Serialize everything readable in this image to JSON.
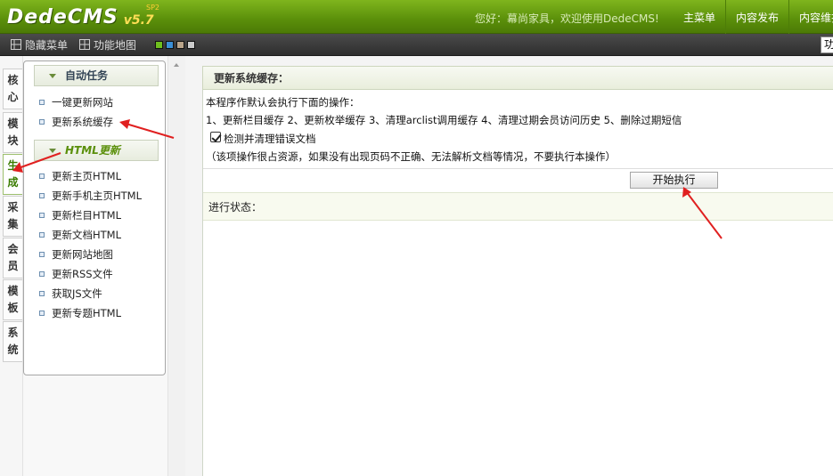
{
  "header": {
    "logo_text": "DedeCMS",
    "logo_version": "v5.7",
    "logo_edition": "SP2",
    "welcome": "您好：幕尚家具，欢迎使用DedeCMS!",
    "nav": [
      "主菜单",
      "内容发布",
      "内容维护"
    ]
  },
  "toolbar": {
    "hide_menu": "隐藏菜单",
    "site_map": "功能地图",
    "skins": [
      "#6fbf1e",
      "#3b8fd6",
      "#b9a48a",
      "#cccccc"
    ],
    "right_box": "功"
  },
  "vtabs": [
    "核心",
    "模块",
    "生成",
    "采集",
    "会员",
    "模板",
    "系统"
  ],
  "menu": {
    "group1_title": "自动任务",
    "group1_items": [
      "一键更新网站",
      "更新系统缓存"
    ],
    "group2_title": "HTML更新",
    "group2_items": [
      "更新主页HTML",
      "更新手机主页HTML",
      "更新栏目HTML",
      "更新文档HTML",
      "更新网站地图",
      "更新RSS文件",
      "获取JS文件",
      "更新专题HTML"
    ]
  },
  "main": {
    "title": "更新系统缓存：",
    "line1": "本程序作默认会执行下面的操作：",
    "line2": "1、更新栏目缓存 2、更新枚举缓存 3、清理arclist调用缓存 4、清理过期会员访问历史 5、删除过期短信",
    "check_label": "检测并清理错误文档",
    "note": "（该项操作很占资源，如果没有出现页码不正确、无法解析文档等情况，不要执行本操作）",
    "button": "开始执行",
    "status_label": "进行状态："
  },
  "colors": {
    "header_green": "#5a8f0a",
    "annotation_red": "#e02020"
  }
}
